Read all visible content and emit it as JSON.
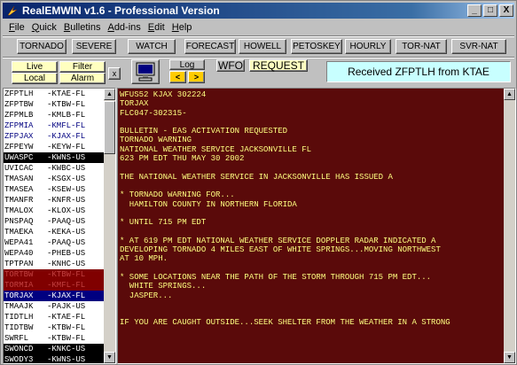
{
  "window": {
    "title": "RealEMWIN v1.6 - Professional Version"
  },
  "caption_buttons": {
    "minimize": "_",
    "maximize": "□",
    "close": "X"
  },
  "menu": [
    {
      "first": "F",
      "rest": "ile"
    },
    {
      "first": "Q",
      "rest": "uick"
    },
    {
      "first": "B",
      "rest": "ulletins"
    },
    {
      "first": "A",
      "rest": "dd-ins"
    },
    {
      "first": "E",
      "rest": "dit"
    },
    {
      "first": "H",
      "rest": "elp"
    }
  ],
  "top_buttons": [
    "TORNADO",
    "SEVERE",
    "WATCH",
    "FORECAST",
    "HOWELL",
    "PETOSKEY",
    "HOURLY",
    "TOR-NAT",
    "SVR-NAT"
  ],
  "controls": {
    "live": "Live",
    "local": "Local",
    "filter": "Filter",
    "alarm": "Alarm",
    "close_x": "x",
    "log": "Log",
    "prev_arrow": "<",
    "next_arrow": ">",
    "wfo": "WFO",
    "request": "REQUEST",
    "status": "Received ZFPTLH from KTAE"
  },
  "bulletins": [
    {
      "id": "ZFPTLH",
      "src": "-KTAE-FL",
      "style": ""
    },
    {
      "id": "ZFPTBW",
      "src": "-KTBW-FL",
      "style": ""
    },
    {
      "id": "ZFPMLB",
      "src": "-KMLB-FL",
      "style": ""
    },
    {
      "id": "ZFPMIA",
      "src": "-KMFL-FL",
      "style": "blue"
    },
    {
      "id": "ZFPJAX",
      "src": "-KJAX-FL",
      "style": "blue"
    },
    {
      "id": "ZFPEYW",
      "src": "-KEYW-FL",
      "style": ""
    },
    {
      "id": "UWASPC",
      "src": "-KWNS-US",
      "style": "sel-black"
    },
    {
      "id": "UVICAC",
      "src": "-KWBC-US",
      "style": ""
    },
    {
      "id": "TMASAN",
      "src": "-KSGX-US",
      "style": ""
    },
    {
      "id": "TMASEA",
      "src": "-KSEW-US",
      "style": ""
    },
    {
      "id": "TMANFR",
      "src": "-KNFR-US",
      "style": ""
    },
    {
      "id": "TMALOX",
      "src": "-KLOX-US",
      "style": ""
    },
    {
      "id": "PNSPAQ",
      "src": "-PAAQ-US",
      "style": ""
    },
    {
      "id": "TMAEKA",
      "src": "-KEKA-US",
      "style": ""
    },
    {
      "id": "WEPA41",
      "src": "-PAAQ-US",
      "style": ""
    },
    {
      "id": "WEPA40",
      "src": "-PHEB-US",
      "style": ""
    },
    {
      "id": "TPTPAN",
      "src": "-KNHC-US",
      "style": ""
    },
    {
      "id": "TORTBW",
      "src": "-KTBW-FL",
      "style": "maroon"
    },
    {
      "id": "TORMIA",
      "src": "-KMFL-FL",
      "style": "maroon"
    },
    {
      "id": "TORJAX",
      "src": "-KJAX-FL",
      "style": "sel-navy"
    },
    {
      "id": "TMAAJK",
      "src": "-PAJK-US",
      "style": ""
    },
    {
      "id": "TIDTLH",
      "src": "-KTAE-FL",
      "style": ""
    },
    {
      "id": "TIDTBW",
      "src": "-KTBW-FL",
      "style": ""
    },
    {
      "id": "SWRFL",
      "src": "-KTBW-FL",
      "style": ""
    },
    {
      "id": "SWONCD",
      "src": "-KNKC-US",
      "style": "sel-black"
    },
    {
      "id": "SWODY3",
      "src": "-KWNS-US",
      "style": "sel-black"
    }
  ],
  "bulletin_text": [
    "WFUS52 KJAX 302224",
    "TORJAX",
    "FLC047-302315-",
    "",
    "BULLETIN - EAS ACTIVATION REQUESTED",
    "TORNADO WARNING",
    "NATIONAL WEATHER SERVICE JACKSONVILLE FL",
    "623 PM EDT THU MAY 30 2002",
    "",
    "THE NATIONAL WEATHER SERVICE IN JACKSONVILLE HAS ISSUED A",
    "",
    "* TORNADO WARNING FOR...",
    "  HAMILTON COUNTY IN NORTHERN FLORIDA",
    "",
    "* UNTIL 715 PM EDT",
    "",
    "* AT 619 PM EDT NATIONAL WEATHER SERVICE DOPPLER RADAR INDICATED A",
    "DEVELOPING TORNADO 4 MILES EAST OF WHITE SPRINGS...MOVING NORTHWEST",
    "AT 10 MPH.",
    "",
    "* SOME LOCATIONS NEAR THE PATH OF THE STORM THROUGH 715 PM EDT...",
    "  WHITE SPRINGS...",
    "  JASPER...",
    "",
    "",
    "IF YOU ARE CAUGHT OUTSIDE...SEEK SHELTER FROM THE WEATHER IN A STRONG"
  ],
  "icons": {
    "app": "lightning-icon",
    "monitor": "monitor-icon"
  }
}
